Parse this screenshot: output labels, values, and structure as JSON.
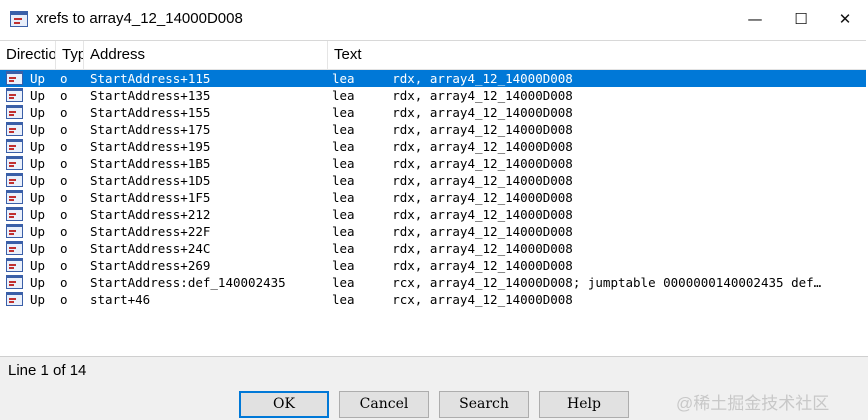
{
  "window": {
    "title": "xrefs to array4_12_14000D008"
  },
  "title_buttons": [
    "—",
    "☐",
    "✕"
  ],
  "columns": [
    "Direction",
    "Type",
    "Address",
    "Text"
  ],
  "rows": [
    {
      "dir": "Up",
      "type": "o",
      "address": "StartAddress+115",
      "text": "lea     rdx, array4_12_14000D008"
    },
    {
      "dir": "Up",
      "type": "o",
      "address": "StartAddress+135",
      "text": "lea     rdx, array4_12_14000D008"
    },
    {
      "dir": "Up",
      "type": "o",
      "address": "StartAddress+155",
      "text": "lea     rdx, array4_12_14000D008"
    },
    {
      "dir": "Up",
      "type": "o",
      "address": "StartAddress+175",
      "text": "lea     rdx, array4_12_14000D008"
    },
    {
      "dir": "Up",
      "type": "o",
      "address": "StartAddress+195",
      "text": "lea     rdx, array4_12_14000D008"
    },
    {
      "dir": "Up",
      "type": "o",
      "address": "StartAddress+1B5",
      "text": "lea     rdx, array4_12_14000D008"
    },
    {
      "dir": "Up",
      "type": "o",
      "address": "StartAddress+1D5",
      "text": "lea     rdx, array4_12_14000D008"
    },
    {
      "dir": "Up",
      "type": "o",
      "address": "StartAddress+1F5",
      "text": "lea     rdx, array4_12_14000D008"
    },
    {
      "dir": "Up",
      "type": "o",
      "address": "StartAddress+212",
      "text": "lea     rdx, array4_12_14000D008"
    },
    {
      "dir": "Up",
      "type": "o",
      "address": "StartAddress+22F",
      "text": "lea     rdx, array4_12_14000D008"
    },
    {
      "dir": "Up",
      "type": "o",
      "address": "StartAddress+24C",
      "text": "lea     rdx, array4_12_14000D008"
    },
    {
      "dir": "Up",
      "type": "o",
      "address": "StartAddress+269",
      "text": "lea     rdx, array4_12_14000D008"
    },
    {
      "dir": "Up",
      "type": "o",
      "address": "StartAddress:def_140002435",
      "text": "lea     rcx, array4_12_14000D008; jumptable 0000000140002435 def…"
    },
    {
      "dir": "Up",
      "type": "o",
      "address": "start+46",
      "text": "lea     rcx, array4_12_14000D008"
    }
  ],
  "selected_row": 0,
  "status": {
    "text": "Line 1 of 14"
  },
  "buttons": {
    "ok": "OK",
    "cancel": "Cancel",
    "search": "Search",
    "help": "Help"
  },
  "watermark": "@稀土掘金技术社区",
  "colors": {
    "selection": "#0078d7",
    "dialog_bg": "#f0f0f0"
  }
}
